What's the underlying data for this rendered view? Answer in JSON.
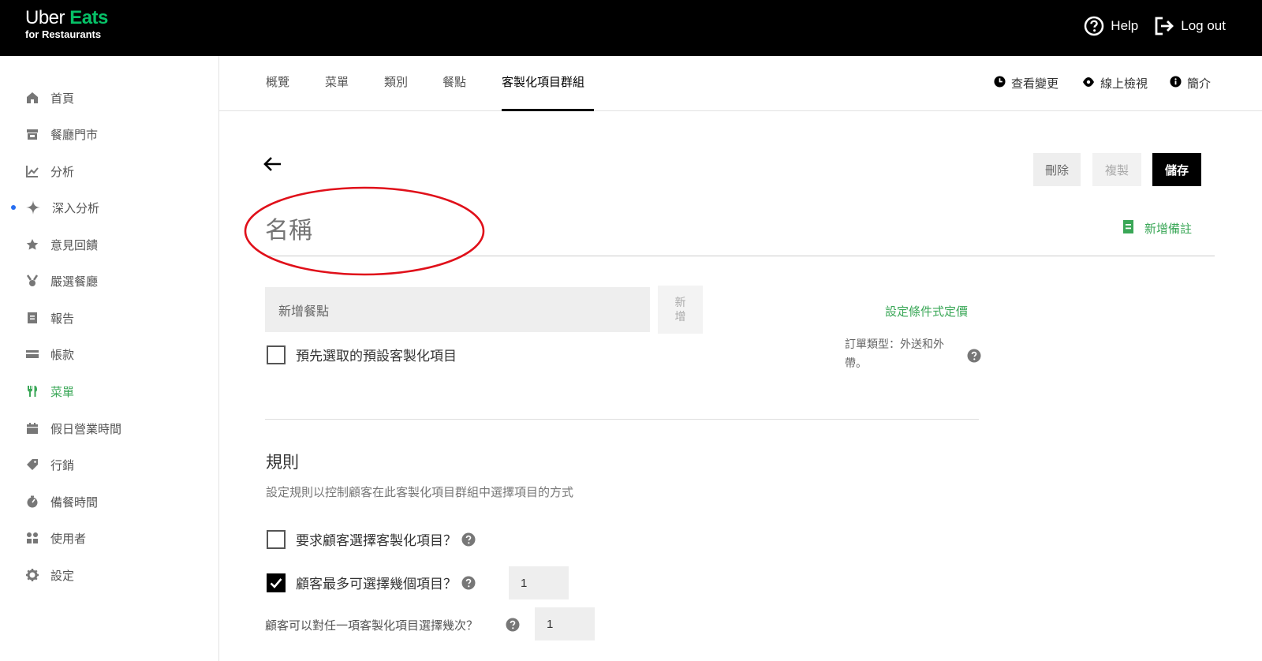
{
  "app": {
    "brand_line1": "Uber",
    "brand_line1_accent": "Eats",
    "brand_line2": "for Restaurants",
    "help_label": "Help",
    "logout_label": "Log out"
  },
  "sidebar": {
    "items": [
      {
        "label": "首頁",
        "icon": "home-icon"
      },
      {
        "label": "餐廳門市",
        "icon": "store-icon"
      },
      {
        "label": "分析",
        "icon": "chart-icon"
      },
      {
        "label": "深入分析",
        "icon": "sparkle-icon"
      },
      {
        "label": "意見回饋",
        "icon": "star-icon"
      },
      {
        "label": "嚴選餐廳",
        "icon": "award-icon"
      },
      {
        "label": "報告",
        "icon": "report-icon"
      },
      {
        "label": "帳款",
        "icon": "card-icon"
      },
      {
        "label": "菜單",
        "icon": "utensils-icon"
      },
      {
        "label": "假日營業時間",
        "icon": "calendar-icon"
      },
      {
        "label": "行銷",
        "icon": "tag-icon"
      },
      {
        "label": "備餐時間",
        "icon": "timer-icon"
      },
      {
        "label": "使用者",
        "icon": "users-icon"
      },
      {
        "label": "設定",
        "icon": "gear-icon"
      }
    ],
    "active_index": 8,
    "dot_index": 3
  },
  "tabs": {
    "items": [
      "概覽",
      "菜單",
      "類別",
      "餐點",
      "客製化項目群組"
    ],
    "active_index": 4,
    "right": {
      "history_label": "查看變更",
      "preview_label": "線上檢視",
      "info_label": "簡介"
    }
  },
  "editor": {
    "delete_label": "刪除",
    "duplicate_label": "複製",
    "save_label": "儲存",
    "name_placeholder": "名稱",
    "add_note_label": "新增備註",
    "add_item_placeholder": "新增餐點",
    "add_button_label": "新增",
    "conditional_price_label": "設定條件式定價",
    "order_type_text": "訂單類型：外送和外帶。",
    "preselect_label": "預先選取的預設客製化項目",
    "preselect_checked": false
  },
  "rules": {
    "title": "規則",
    "description": "設定規則以控制顧客在此客製化項目群組中選擇項目的方式",
    "require_label": "要求顧客選擇客製化項目？",
    "require_checked": false,
    "max_label": "顧客最多可選擇幾個項目？",
    "max_checked": true,
    "max_value": "1",
    "repeat_label": "顧客可以對任一項客製化項目選擇幾次？",
    "repeat_value": "1"
  },
  "annotation": {
    "color": "#e0101a"
  }
}
